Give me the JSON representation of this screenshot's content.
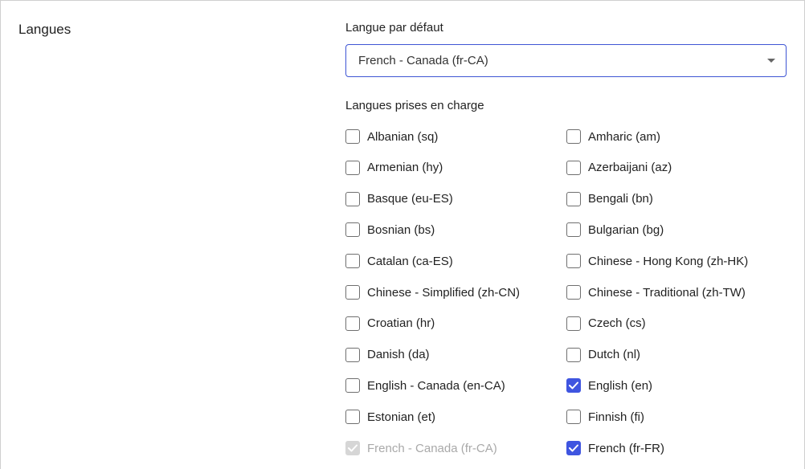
{
  "section": {
    "title": "Langues"
  },
  "default_language": {
    "label": "Langue par défaut",
    "selected": "French - Canada (fr-CA)"
  },
  "supported_languages": {
    "label": "Langues prises en charge",
    "items": [
      {
        "label": "Albanian (sq)",
        "checked": false,
        "disabled": false
      },
      {
        "label": "Amharic (am)",
        "checked": false,
        "disabled": false
      },
      {
        "label": "Armenian (hy)",
        "checked": false,
        "disabled": false
      },
      {
        "label": "Azerbaijani (az)",
        "checked": false,
        "disabled": false
      },
      {
        "label": "Basque (eu-ES)",
        "checked": false,
        "disabled": false
      },
      {
        "label": "Bengali (bn)",
        "checked": false,
        "disabled": false
      },
      {
        "label": "Bosnian (bs)",
        "checked": false,
        "disabled": false
      },
      {
        "label": "Bulgarian (bg)",
        "checked": false,
        "disabled": false
      },
      {
        "label": "Catalan (ca-ES)",
        "checked": false,
        "disabled": false
      },
      {
        "label": "Chinese - Hong Kong (zh-HK)",
        "checked": false,
        "disabled": false
      },
      {
        "label": "Chinese - Simplified (zh-CN)",
        "checked": false,
        "disabled": false
      },
      {
        "label": "Chinese - Traditional (zh-TW)",
        "checked": false,
        "disabled": false
      },
      {
        "label": "Croatian (hr)",
        "checked": false,
        "disabled": false
      },
      {
        "label": "Czech (cs)",
        "checked": false,
        "disabled": false
      },
      {
        "label": "Danish (da)",
        "checked": false,
        "disabled": false
      },
      {
        "label": "Dutch (nl)",
        "checked": false,
        "disabled": false
      },
      {
        "label": "English - Canada (en-CA)",
        "checked": false,
        "disabled": false
      },
      {
        "label": "English (en)",
        "checked": true,
        "disabled": false
      },
      {
        "label": "Estonian (et)",
        "checked": false,
        "disabled": false
      },
      {
        "label": "Finnish (fi)",
        "checked": false,
        "disabled": false
      },
      {
        "label": "French - Canada (fr-CA)",
        "checked": true,
        "disabled": true
      },
      {
        "label": "French (fr-FR)",
        "checked": true,
        "disabled": false
      }
    ]
  },
  "colors": {
    "accent": "#3f55e0",
    "disabled": "#d6d6d6"
  }
}
